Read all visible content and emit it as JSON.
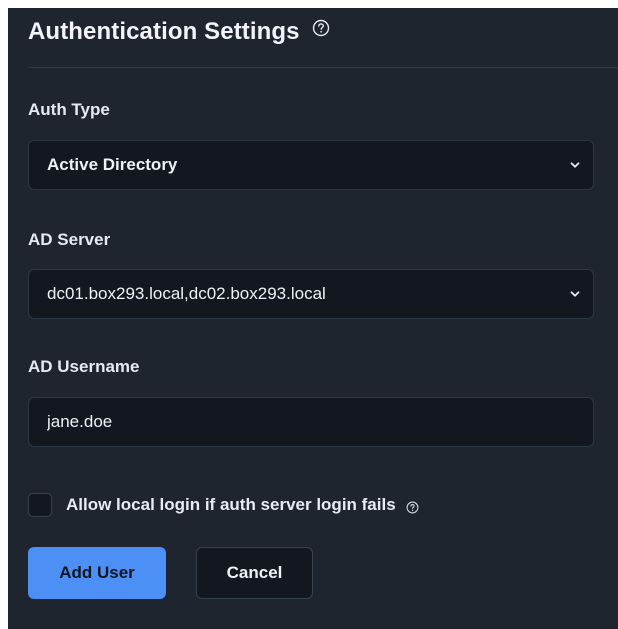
{
  "header": {
    "title": "Authentication Settings",
    "help_icon": "question-circle-icon"
  },
  "fields": {
    "auth_type": {
      "label": "Auth Type",
      "value": "Active Directory"
    },
    "ad_server": {
      "label": "AD Server",
      "value": "dc01.box293.local,dc02.box293.local"
    },
    "ad_username": {
      "label": "AD Username",
      "value": "jane.doe"
    }
  },
  "options": {
    "allow_local_login": {
      "label": "Allow local login if auth server login fails",
      "checked": false
    }
  },
  "actions": {
    "add_user_label": "Add User",
    "cancel_label": "Cancel"
  },
  "colors": {
    "panel_bg": "#1e252e",
    "input_bg": "#131820",
    "accent": "#4c8ff5",
    "text": "#e8ecf1"
  }
}
